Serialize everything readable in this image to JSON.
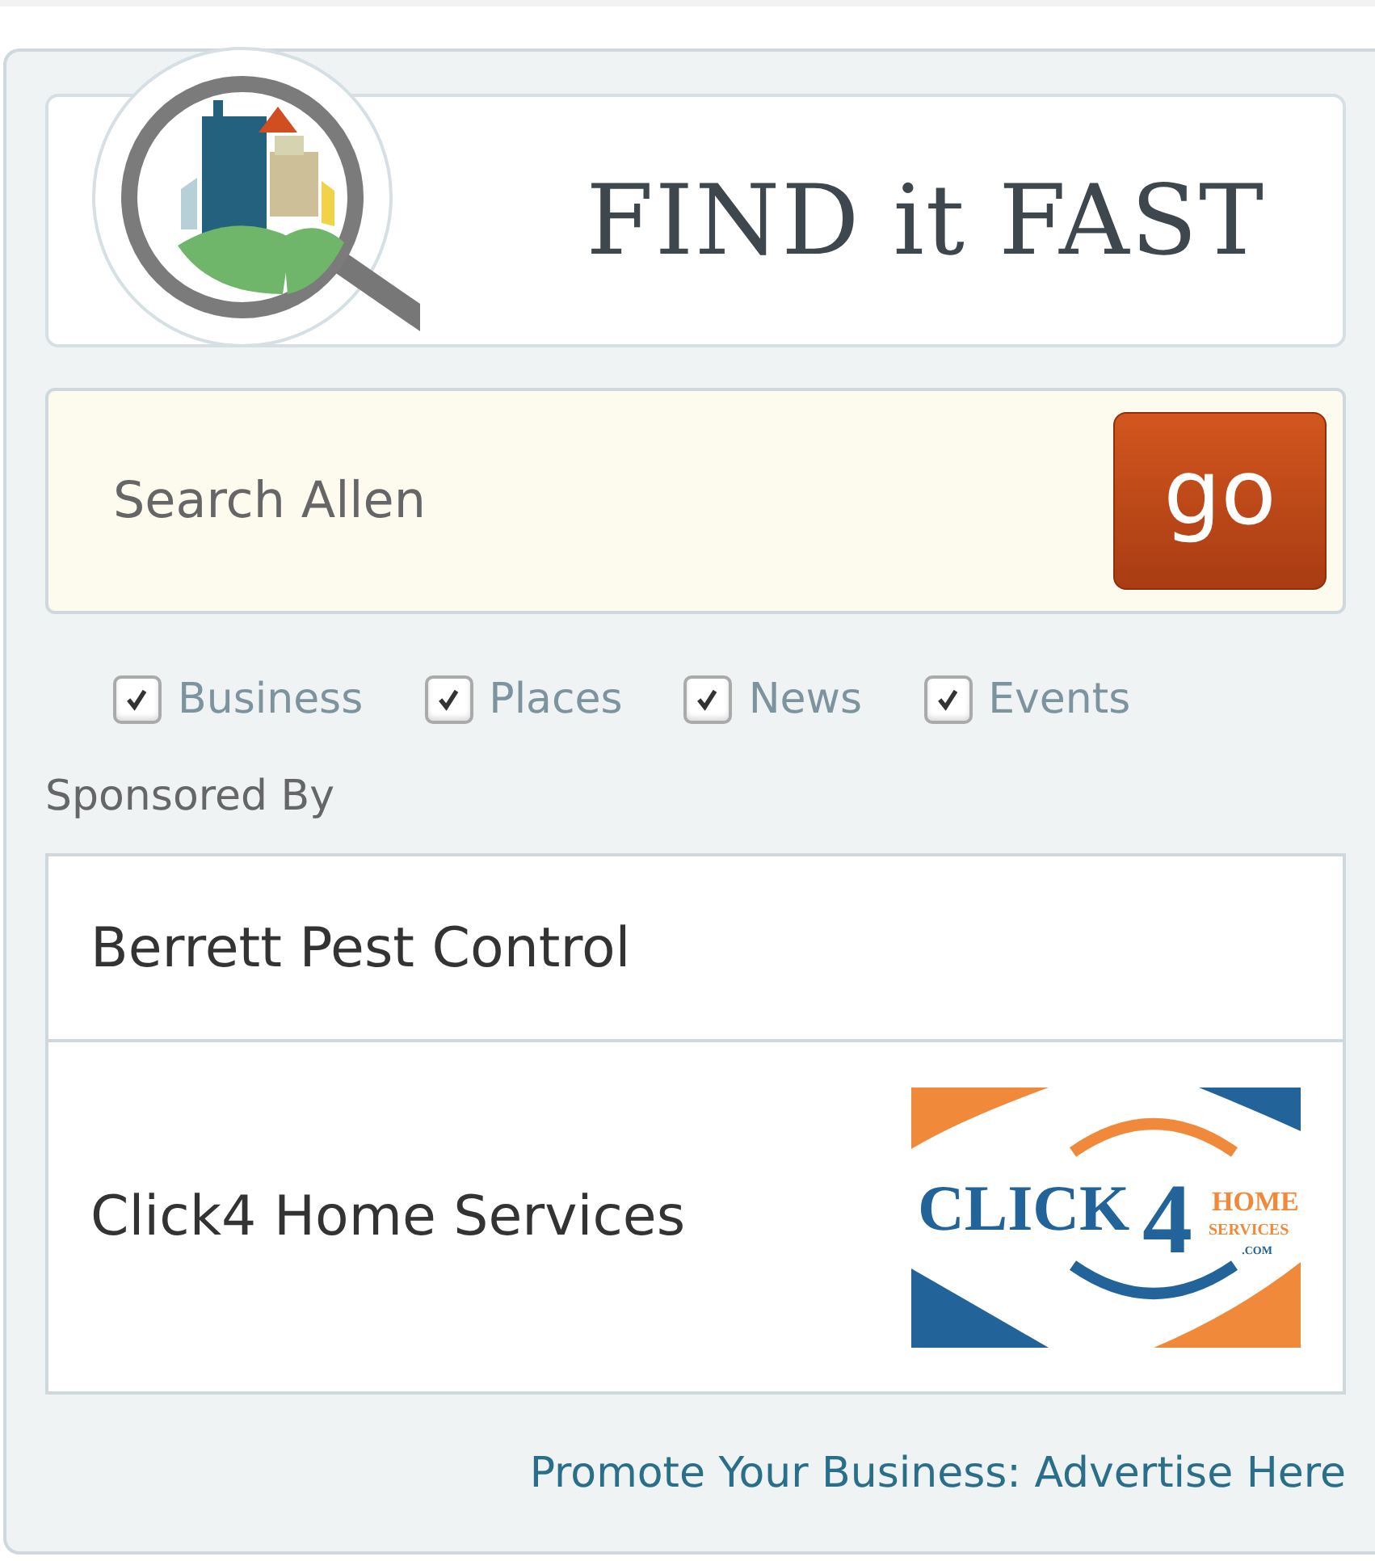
{
  "logo": {
    "title": "FIND it FAST"
  },
  "search": {
    "placeholder": "Search Allen",
    "button": "go"
  },
  "filters": [
    {
      "label": "Business",
      "checked": true
    },
    {
      "label": "Places",
      "checked": true
    },
    {
      "label": "News",
      "checked": true
    },
    {
      "label": "Events",
      "checked": true
    }
  ],
  "sponsored_heading": "Sponsored By",
  "sponsors": [
    {
      "name": "Berrett Pest Control"
    },
    {
      "name": "Click4 Home Services",
      "logo": {
        "word": "CLICK",
        "number": "4",
        "line_1": "HOME",
        "line_2": "SERVICES",
        "suffix": ".COM"
      }
    }
  ],
  "footer_link": "Promote Your Business: Advertise Here"
}
